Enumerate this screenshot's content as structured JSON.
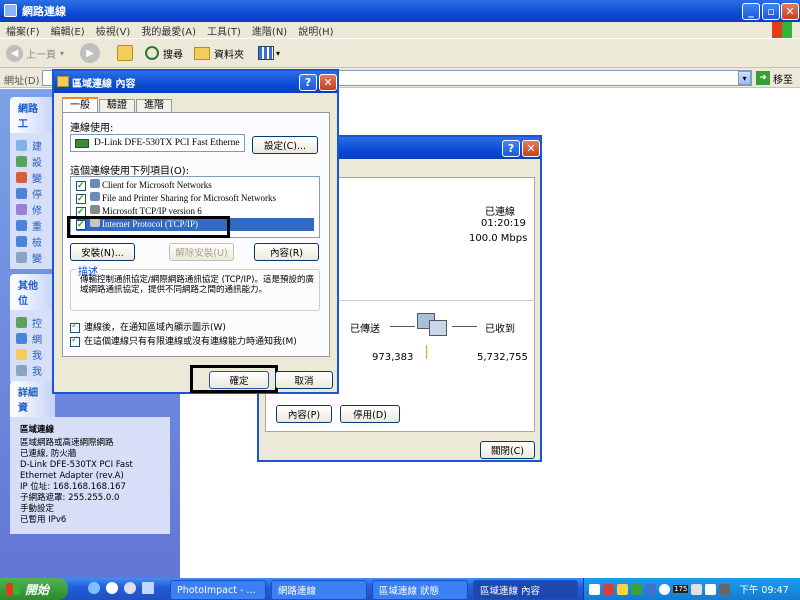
{
  "explorer": {
    "title": "網路連線",
    "menu": [
      "檔案(F)",
      "編輯(E)",
      "檢視(V)",
      "我的最愛(A)",
      "工具(T)",
      "進階(N)",
      "說明(H)"
    ],
    "back_label": "上一頁",
    "search_label": "搜尋",
    "folders_label": "資料夾",
    "address_label": "網址(D)",
    "go_label": "移至"
  },
  "sidebar": {
    "tasks_header": "網路工",
    "tasks": [
      "建",
      "設",
      "變",
      "停",
      "修",
      "重",
      "檢",
      "變"
    ],
    "other_header": "其他位",
    "other": [
      "控",
      "網",
      "我",
      "我"
    ],
    "details_header": "詳細資",
    "details": {
      "name": "區域連線",
      "type": "區域網路或高速網際網路",
      "status": "已連線, 防火牆",
      "adapter": "D-Link DFE-530TX PCI Fast Ethernet Adapter (rev.A)",
      "ip": "IP 位址: 168.168.168.167",
      "mask": "子網路遮罩: 255.255.0.0",
      "assign": "手動設定",
      "ipv6": "已暫用 IPv6"
    }
  },
  "status_dialog": {
    "status_value": "已連線",
    "duration": "01:20:19",
    "speed": "100.0 Mbps",
    "sent_label": "已傳送",
    "received_label": "已收到",
    "sent_value": "973,383",
    "received_value": "5,732,755",
    "properties_button": "內容(P)",
    "disable_button": "停用(D)",
    "close_button": "關閉(C)"
  },
  "props_dialog": {
    "title": "區域連線 內容",
    "tabs": [
      "一般",
      "驗證",
      "進階"
    ],
    "connect_using_label": "連線使用:",
    "adapter": "D-Link DFE-530TX PCI Fast Etherne",
    "configure_button": "設定(C)...",
    "items_label": "這個連線使用下列項目(O):",
    "items": [
      "Client for Microsoft Networks",
      "File and Printer Sharing for Microsoft Networks",
      "Microsoft TCP/IP version 6",
      "Internet Protocol (TCP/IP)"
    ],
    "install_button": "安裝(N)...",
    "uninstall_button": "解除安裝(U)",
    "properties_button": "內容(R)",
    "description_label": "描述",
    "description": "傳輸控制通訊協定/網際網路通訊協定 (TCP/IP)。這是預設的廣域網路通訊協定，提供不同網路之間的通訊能力。",
    "show_icon_label": "連線後，在通知區域內顯示圖示(W)",
    "notify_label": "在這個連線只有有限連線或沒有連線能力時通知我(M)",
    "ok_button": "確定",
    "cancel_button": "取消"
  },
  "taskbar": {
    "start_label": "開始",
    "tasks": [
      "PhotoImpact - ...",
      "網路連線",
      "區域連線 狀態",
      "區域連線 內容"
    ],
    "tray_badge": "175",
    "clock": "下午 09:47"
  }
}
